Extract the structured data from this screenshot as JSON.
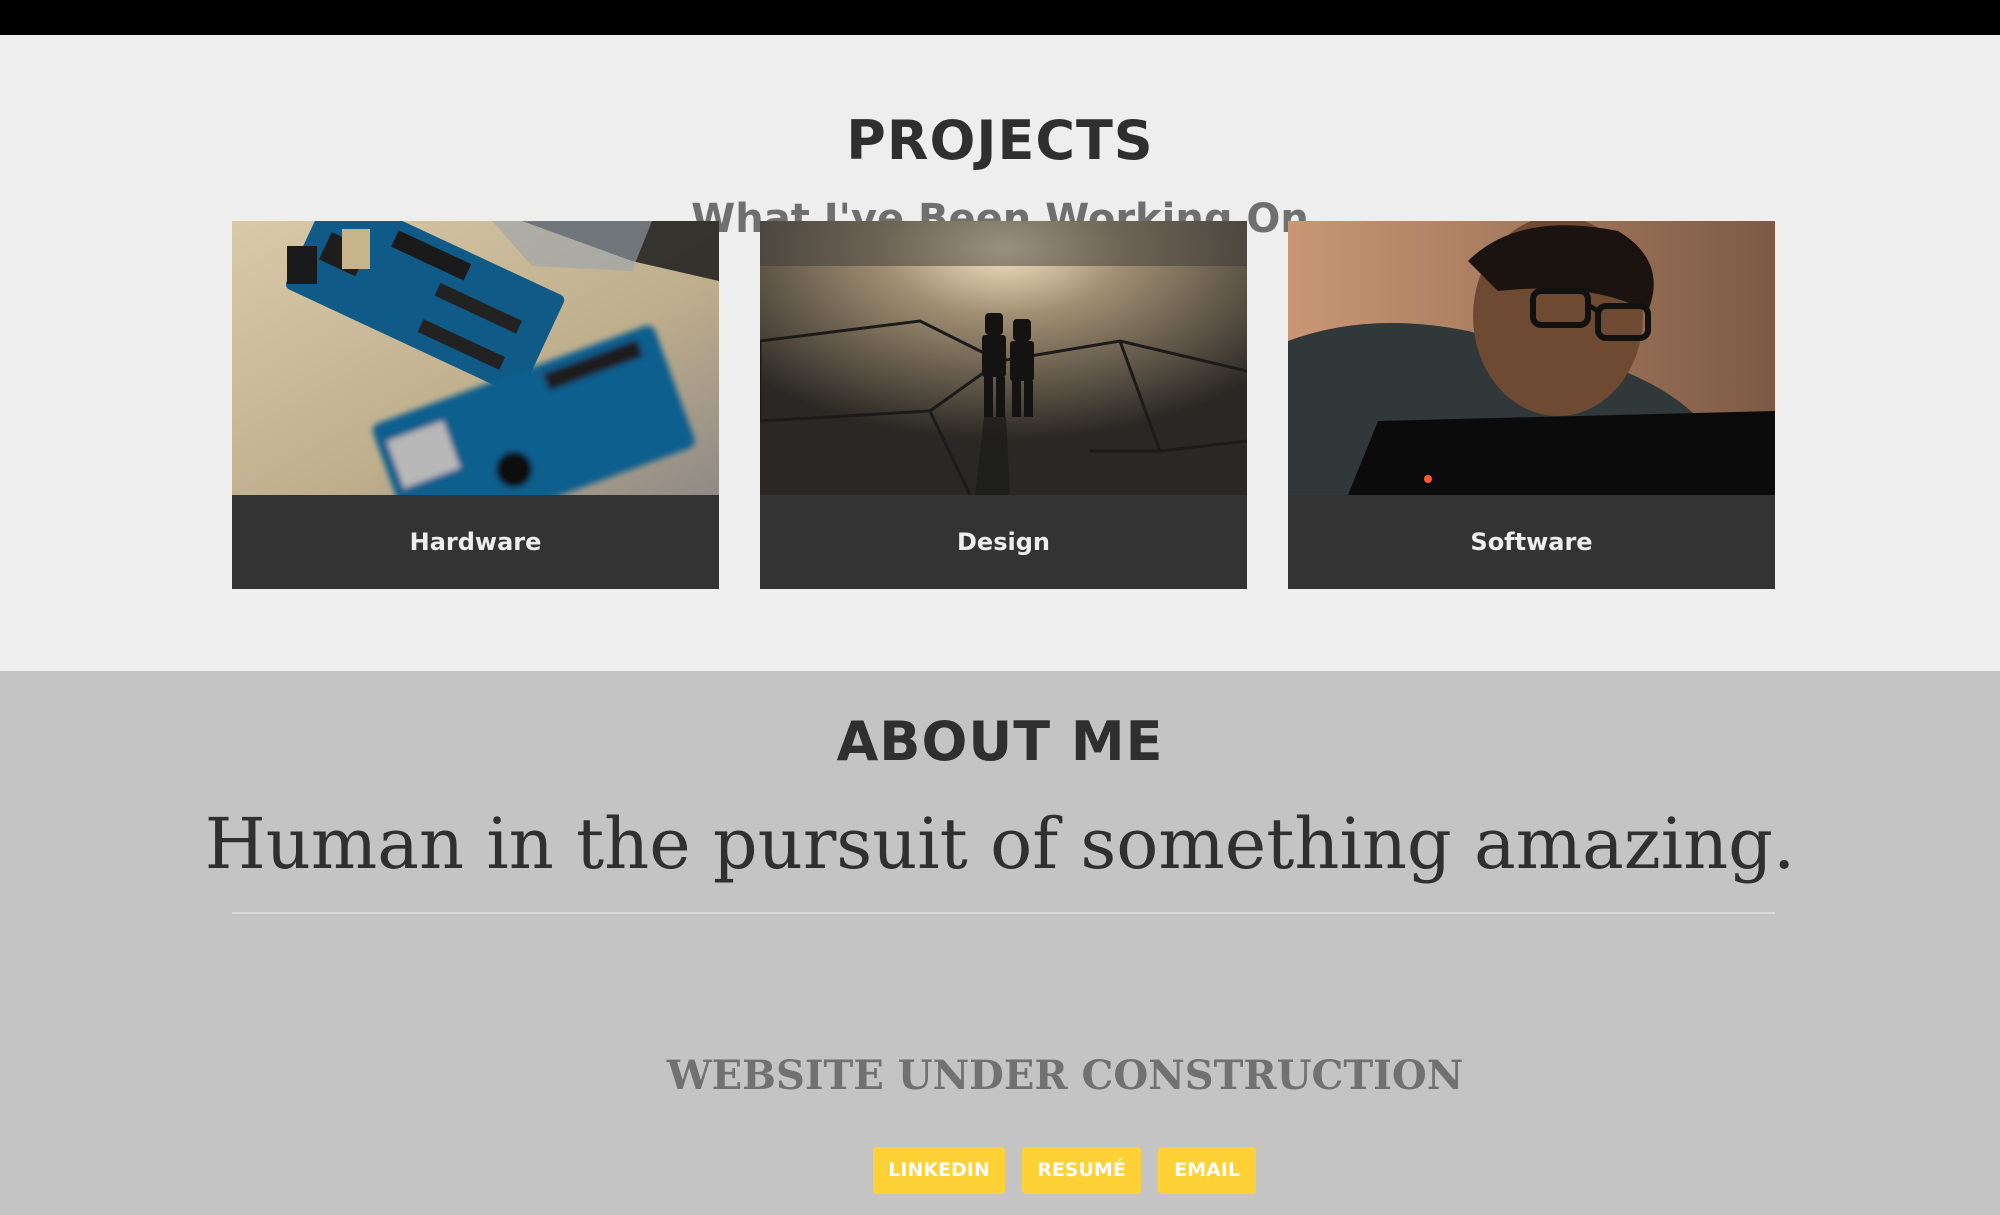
{
  "projects": {
    "title": "PROJECTS",
    "subtitle": "What I've Been Working On",
    "cards": [
      {
        "label": "Hardware",
        "image": "arduino-boards-photo"
      },
      {
        "label": "Design",
        "image": "lego-figures-silhouette-photo"
      },
      {
        "label": "Software",
        "image": "person-at-laptop-photo"
      }
    ]
  },
  "about": {
    "title": "ABOUT ME",
    "tagline": "Human in the pursuit of something amazing.",
    "construction": "WEBSITE UNDER CONSTRUCTION",
    "buttons": {
      "linkedin": "LINKEDIN",
      "resume": "RESUMÉ",
      "email": "EMAIL"
    }
  },
  "colors": {
    "topbar": "#000000",
    "projects_bg": "#eeeeee",
    "about_bg": "#c4c4c4",
    "caption_bg": "#333333",
    "accent": "#fed136"
  }
}
